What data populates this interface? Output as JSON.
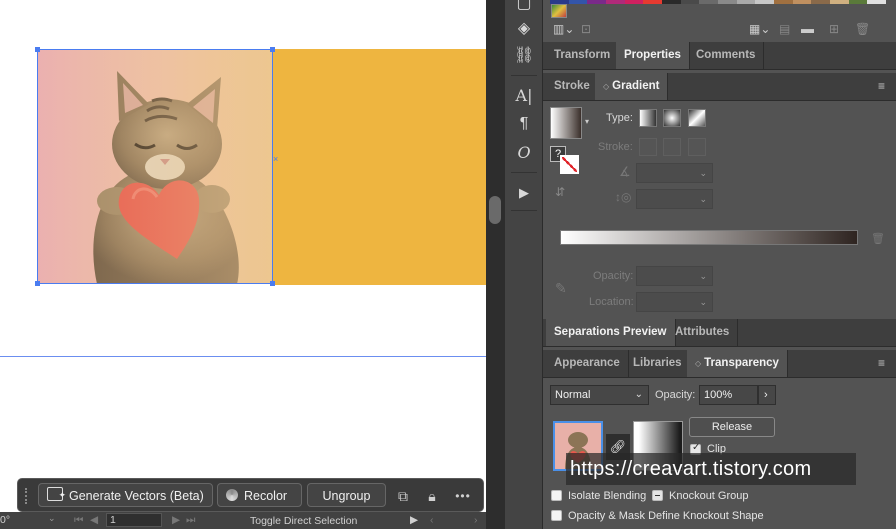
{
  "canvas": {
    "artboard_color": "#ffffff",
    "rect_color": "#eeb540",
    "image_bg_colors": [
      "#ebb0b0",
      "#edc790"
    ],
    "selection_color": "#4a7cf0"
  },
  "taskbar": {
    "generate_vectors_label": "Generate Vectors (Beta)",
    "recolor_label": "Recolor",
    "ungroup_label": "Ungroup",
    "more_label": "•••"
  },
  "statusbar": {
    "rotation": "0°",
    "artboard_number": "1",
    "tool_hint": "Toggle Direct Selection"
  },
  "swatch_colors": [
    "#2a3a8a",
    "#3355aa",
    "#7a2a8a",
    "#b02a7a",
    "#d02060",
    "#e63a30",
    "#2a2a2a",
    "#4a4a4a",
    "#6a6a6a",
    "#8a8a8a",
    "#aaaaaa",
    "#c8c8c8",
    "#a07040",
    "#c09060",
    "#8a6a4a",
    "#d0b080",
    "#5a7a3a",
    "#e0e0e0"
  ],
  "top_tabs": {
    "items": [
      "Transform",
      "Properties",
      "Comments"
    ],
    "active": "Properties"
  },
  "gradient_panel": {
    "tabs": [
      "Stroke",
      "Gradient"
    ],
    "type_label": "Type:",
    "stroke_label": "Stroke:",
    "opacity_label": "Opacity:",
    "location_label": "Location:",
    "question_mark": "?"
  },
  "separations_tabs": {
    "items": [
      "Separations Preview",
      "Attributes"
    ]
  },
  "transparency_panel": {
    "tabs": [
      "Appearance",
      "Libraries",
      "Transparency"
    ],
    "blend_mode": "Normal",
    "opacity_label": "Opacity:",
    "opacity_value": "100%",
    "release_label": "Release",
    "clip_label": "Clip",
    "isolate_label": "Isolate Blending",
    "knockout_label": "Knockout Group",
    "opacity_mask_label": "Opacity & Mask Define Knockout Shape",
    "clip_checked": true
  },
  "watermark": {
    "text": "https://creavart.tistory.com"
  },
  "icons": {
    "toolstrip": [
      "layers-icon",
      "links-icon",
      "character-icon",
      "paragraph-icon",
      "opentype-icon",
      "actions-icon"
    ]
  }
}
